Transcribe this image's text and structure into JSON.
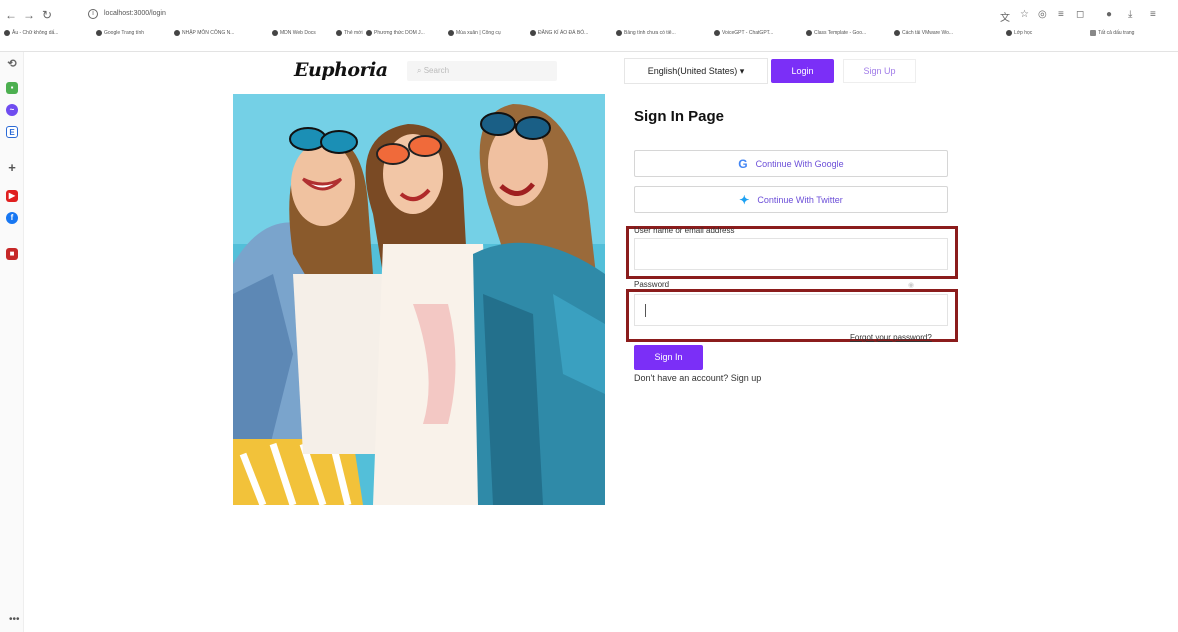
{
  "browser": {
    "url": "localhost:3000/login",
    "bookmarks": [
      "Âu - Chữ không dấ...",
      "Google Trang tính",
      "NHẬP MÔN CÔNG N...",
      "MDN Web Docs",
      "Thẻ mới",
      "Phương thức DOM J...",
      "Mùa xuân | Công cụ",
      "ĐĂNG KÍ ÁO ĐÁ BÓ...",
      "Bảng tính chưa có tiê...",
      "VoiceGPT - ChatGPT...",
      "Class Template - Goo...",
      "Cách tải VMware Wo...",
      "Lớp học",
      "Tất cả dấu trang"
    ]
  },
  "header": {
    "logo": "Euphoria",
    "search_placeholder": "Search",
    "language": "English(United States) ▾",
    "login_label": "Login",
    "signup_label": "Sign Up"
  },
  "form": {
    "title": "Sign In Page",
    "google_label": "Continue With Google",
    "twitter_label": "Continue With Twitter",
    "username_label": "User name or email address",
    "password_label": "Password",
    "forgot_label": "Forgot your password?",
    "signin_label": "Sign In",
    "no_account_label": "Don't have an account? Sign up"
  },
  "colors": {
    "accent": "#7b2ff7",
    "highlight_border": "#8b1c1c"
  }
}
